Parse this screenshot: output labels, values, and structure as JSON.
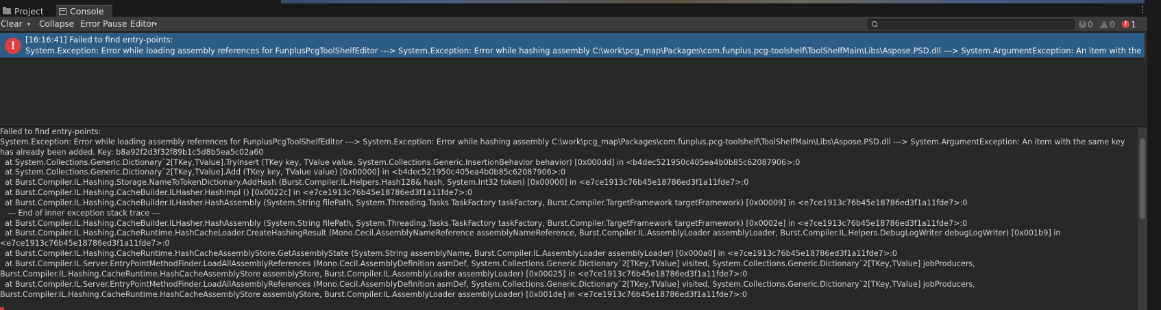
{
  "tabs": {
    "project": "Project",
    "console": "Console"
  },
  "toolbar": {
    "clear": "Clear",
    "clear_arrow": "▾",
    "collapse": "Collapse",
    "error_pause": "Error Pause",
    "editor": "Editor",
    "editor_arrow": "▾",
    "search_placeholder": "",
    "info_count": "0",
    "warning_count": "0",
    "error_count": "1"
  },
  "entry": {
    "line1": "[16:16:41] Failed to find entry-points:",
    "line2": "System.Exception: Error while loading assembly references for FunplusPcgToolShelfEditor ---> System.Exception: Error while hashing assembly C:\\work\\pcg_map\\Packages\\com.funplus.pcg-toolshelf\\ToolShelfMain\\Libs\\Aspose.PSD.dll ---> System.ArgumentException: An item with the same k"
  },
  "detail_lines": [
    "Failed to find entry-points:",
    "System.Exception: Error while loading assembly references for FunplusPcgToolShelfEditor ---> System.Exception: Error while hashing assembly C:\\work\\pcg_map\\Packages\\com.funplus.pcg-toolshelf\\ToolShelfMain\\Libs\\Aspose.PSD.dll ---> System.ArgumentException: An item with the same key",
    "has already been added. Key: b8a92f2d3f32f89b1c5d8b5ea5c02a60",
    "  at System.Collections.Generic.Dictionary`2[TKey,TValue].TryInsert (TKey key, TValue value, System.Collections.Generic.InsertionBehavior behavior) [0x000dd] in <b4dec521950c405ea4b0b85c62087906>:0",
    "  at System.Collections.Generic.Dictionary`2[TKey,TValue].Add (TKey key, TValue value) [0x00000] in <b4dec521950c405ea4b0b85c62087906>:0",
    "  at Burst.Compiler.IL.Hashing.Storage.NameToTokenDictionary.AddHash (Burst.Compiler.IL.Helpers.Hash128& hash, System.Int32 token) [0x00000] in <e7ce1913c76b45e18786ed3f1a11fde7>:0",
    "  at Burst.Compiler.IL.Hashing.CacheBuilder.ILHasher.HashImpl () [0x0022c] in <e7ce1913c76b45e18786ed3f1a11fde7>:0",
    "  at Burst.Compiler.IL.Hashing.CacheBuilder.ILHasher.HashAssembly (System.String filePath, System.Threading.Tasks.TaskFactory taskFactory, Burst.Compiler.TargetFramework targetFramework) [0x00009] in <e7ce1913c76b45e18786ed3f1a11fde7>:0",
    "   --- End of inner exception stack trace ---",
    "  at Burst.Compiler.IL.Hashing.CacheBuilder.ILHasher.HashAssembly (System.String filePath, System.Threading.Tasks.TaskFactory taskFactory, Burst.Compiler.TargetFramework targetFramework) [0x0002e] in <e7ce1913c76b45e18786ed3f1a11fde7>:0",
    "  at Burst.Compiler.IL.Hashing.CacheRuntime.HashCacheLoader.CreateHashingResult (Mono.Cecil.AssemblyNameReference assemblyNameReference, Burst.Compiler.IL.AssemblyLoader assemblyLoader, Burst.Compiler.IL.Helpers.DebugLogWriter debugLogWriter) [0x001b9] in",
    "<e7ce1913c76b45e18786ed3f1a11fde7>:0",
    "  at Burst.Compiler.IL.Hashing.CacheRuntime.HashCacheAssemblyStore.GetAssemblyState (System.String assemblyName, Burst.Compiler.IL.AssemblyLoader assemblyLoader) [0x000a0] in <e7ce1913c76b45e18786ed3f1a11fde7>:0",
    "  at Burst.Compiler.IL.Server.EntryPointMethodFinder.LoadAllAssemblyReferences (Mono.Cecil.AssemblyDefinition asmDef, System.Collections.Generic.Dictionary`2[TKey,TValue] visited, System.Collections.Generic.Dictionary`2[TKey,TValue] jobProducers,",
    "Burst.Compiler.IL.Hashing.CacheRuntime.HashCacheAssemblyStore assemblyStore, Burst.Compiler.IL.AssemblyLoader assemblyLoader) [0x00025] in <e7ce1913c76b45e18786ed3f1a11fde7>:0",
    "  at Burst.Compiler.IL.Server.EntryPointMethodFinder.LoadAllAssemblyReferences (Mono.Cecil.AssemblyDefinition asmDef, System.Collections.Generic.Dictionary`2[TKey,TValue] visited, System.Collections.Generic.Dictionary`2[TKey,TValue] jobProducers,",
    "Burst.Compiler.IL.Hashing.CacheRuntime.HashCacheAssemblyStore assemblyStore, Burst.Compiler.IL.AssemblyLoader assemblyLoader) [0x001de] in <e7ce1913c76b45e18786ed3f1a11fde7>:0"
  ]
}
